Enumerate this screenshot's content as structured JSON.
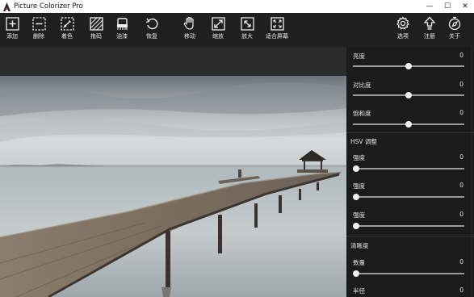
{
  "window": {
    "title": "Picture Colorizer Pro",
    "minimize": "—",
    "maximize": "☐",
    "close": "✕"
  },
  "toolbar": {
    "left": [
      {
        "id": "add",
        "label": "添加",
        "icon": "add-square-icon"
      },
      {
        "id": "delete",
        "label": "删除",
        "icon": "remove-square-icon"
      },
      {
        "id": "colorize",
        "label": "着色",
        "icon": "pencil-square-icon"
      },
      {
        "id": "brush",
        "label": "拖码",
        "icon": "hatch-square-icon"
      },
      {
        "id": "erase",
        "label": "油漆",
        "icon": "bucket-icon"
      },
      {
        "id": "restore",
        "label": "恢复",
        "icon": "undo-icon"
      },
      {
        "id": "move",
        "label": "移动",
        "icon": "hand-icon"
      },
      {
        "id": "zoom",
        "label": "缩放",
        "icon": "resize-icon"
      },
      {
        "id": "zoomin",
        "label": "放大",
        "icon": "zoom-in-icon"
      },
      {
        "id": "fit",
        "label": "适合屏幕",
        "icon": "fit-screen-icon"
      }
    ],
    "right": [
      {
        "id": "options",
        "label": "选项",
        "icon": "gear-icon"
      },
      {
        "id": "register",
        "label": "注册",
        "icon": "upload-icon"
      },
      {
        "id": "about",
        "label": "关于",
        "icon": "compass-icon"
      }
    ]
  },
  "panel": {
    "sliders_top": [
      {
        "label": "亮度",
        "value": "0",
        "level": 0.5
      },
      {
        "label": "对比度",
        "value": "0",
        "level": 0.5
      },
      {
        "label": "饱和度",
        "value": "0",
        "level": 0.5
      }
    ],
    "hsv": {
      "title": "HSV 调整",
      "sliders": [
        {
          "label": "强度",
          "value": "0",
          "level": 0.0
        },
        {
          "label": "强度",
          "value": "0",
          "level": 0.0
        },
        {
          "label": "强度",
          "value": "0",
          "level": 0.0
        }
      ]
    },
    "sharpen": {
      "title": "清晰度",
      "sliders": [
        {
          "label": "数量",
          "value": "0",
          "level": 0.0
        },
        {
          "label": "半径",
          "value": "0",
          "level": 0.0
        }
      ]
    }
  },
  "colors": {
    "toolbar_bg": "#1f1f1f",
    "panel_bg": "#1b1b1b",
    "accent": "#f0f0f0"
  }
}
